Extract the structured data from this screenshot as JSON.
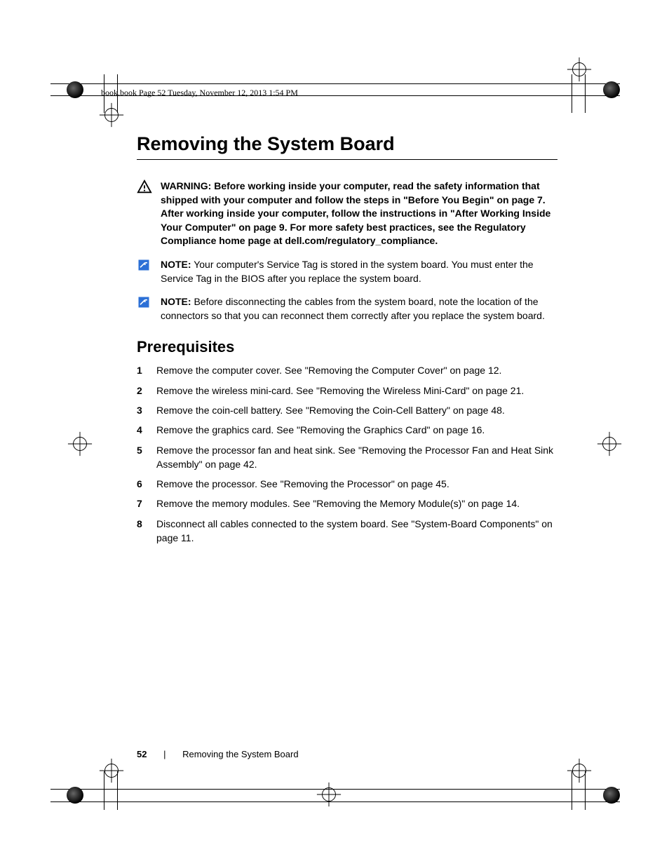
{
  "print_header": "book.book  Page 52  Tuesday, November 12, 2013  1:54 PM",
  "main_title": "Removing the System Board",
  "warning": {
    "label": "WARNING:",
    "text": "Before working inside your computer, read the safety information that shipped with your computer and follow the steps in \"Before You Begin\" on page 7. After working inside your computer, follow the instructions in \"After Working Inside Your Computer\" on page 9. For more safety best practices, see the Regulatory Compliance home page at dell.com/regulatory_compliance."
  },
  "notes": [
    {
      "label": "NOTE:",
      "text": "Your computer's Service Tag is stored in the system board. You must enter the Service Tag in the BIOS after you replace the system board."
    },
    {
      "label": "NOTE:",
      "text": "Before disconnecting the cables from the system board, note the location of the connectors so that you can reconnect them correctly after you replace the system board."
    }
  ],
  "section_heading": "Prerequisites",
  "steps": [
    "Remove the computer cover. See \"Removing the Computer Cover\" on page 12.",
    "Remove the wireless mini-card. See \"Removing the Wireless Mini-Card\" on page 21.",
    "Remove the coin-cell battery. See \"Removing the Coin-Cell Battery\" on page 48.",
    "Remove the graphics card. See \"Removing the Graphics Card\" on page 16.",
    "Remove the processor fan and heat sink. See \"Removing the Processor Fan and Heat Sink Assembly\" on page 42.",
    "Remove the processor. See \"Removing the Processor\" on page 45.",
    "Remove the memory modules. See \"Removing the Memory Module(s)\" on page 14.",
    "Disconnect all cables connected to the system board. See \"System-Board Components\" on page 11."
  ],
  "footer": {
    "page_number": "52",
    "separator": "|",
    "chapter": "Removing the System Board"
  }
}
